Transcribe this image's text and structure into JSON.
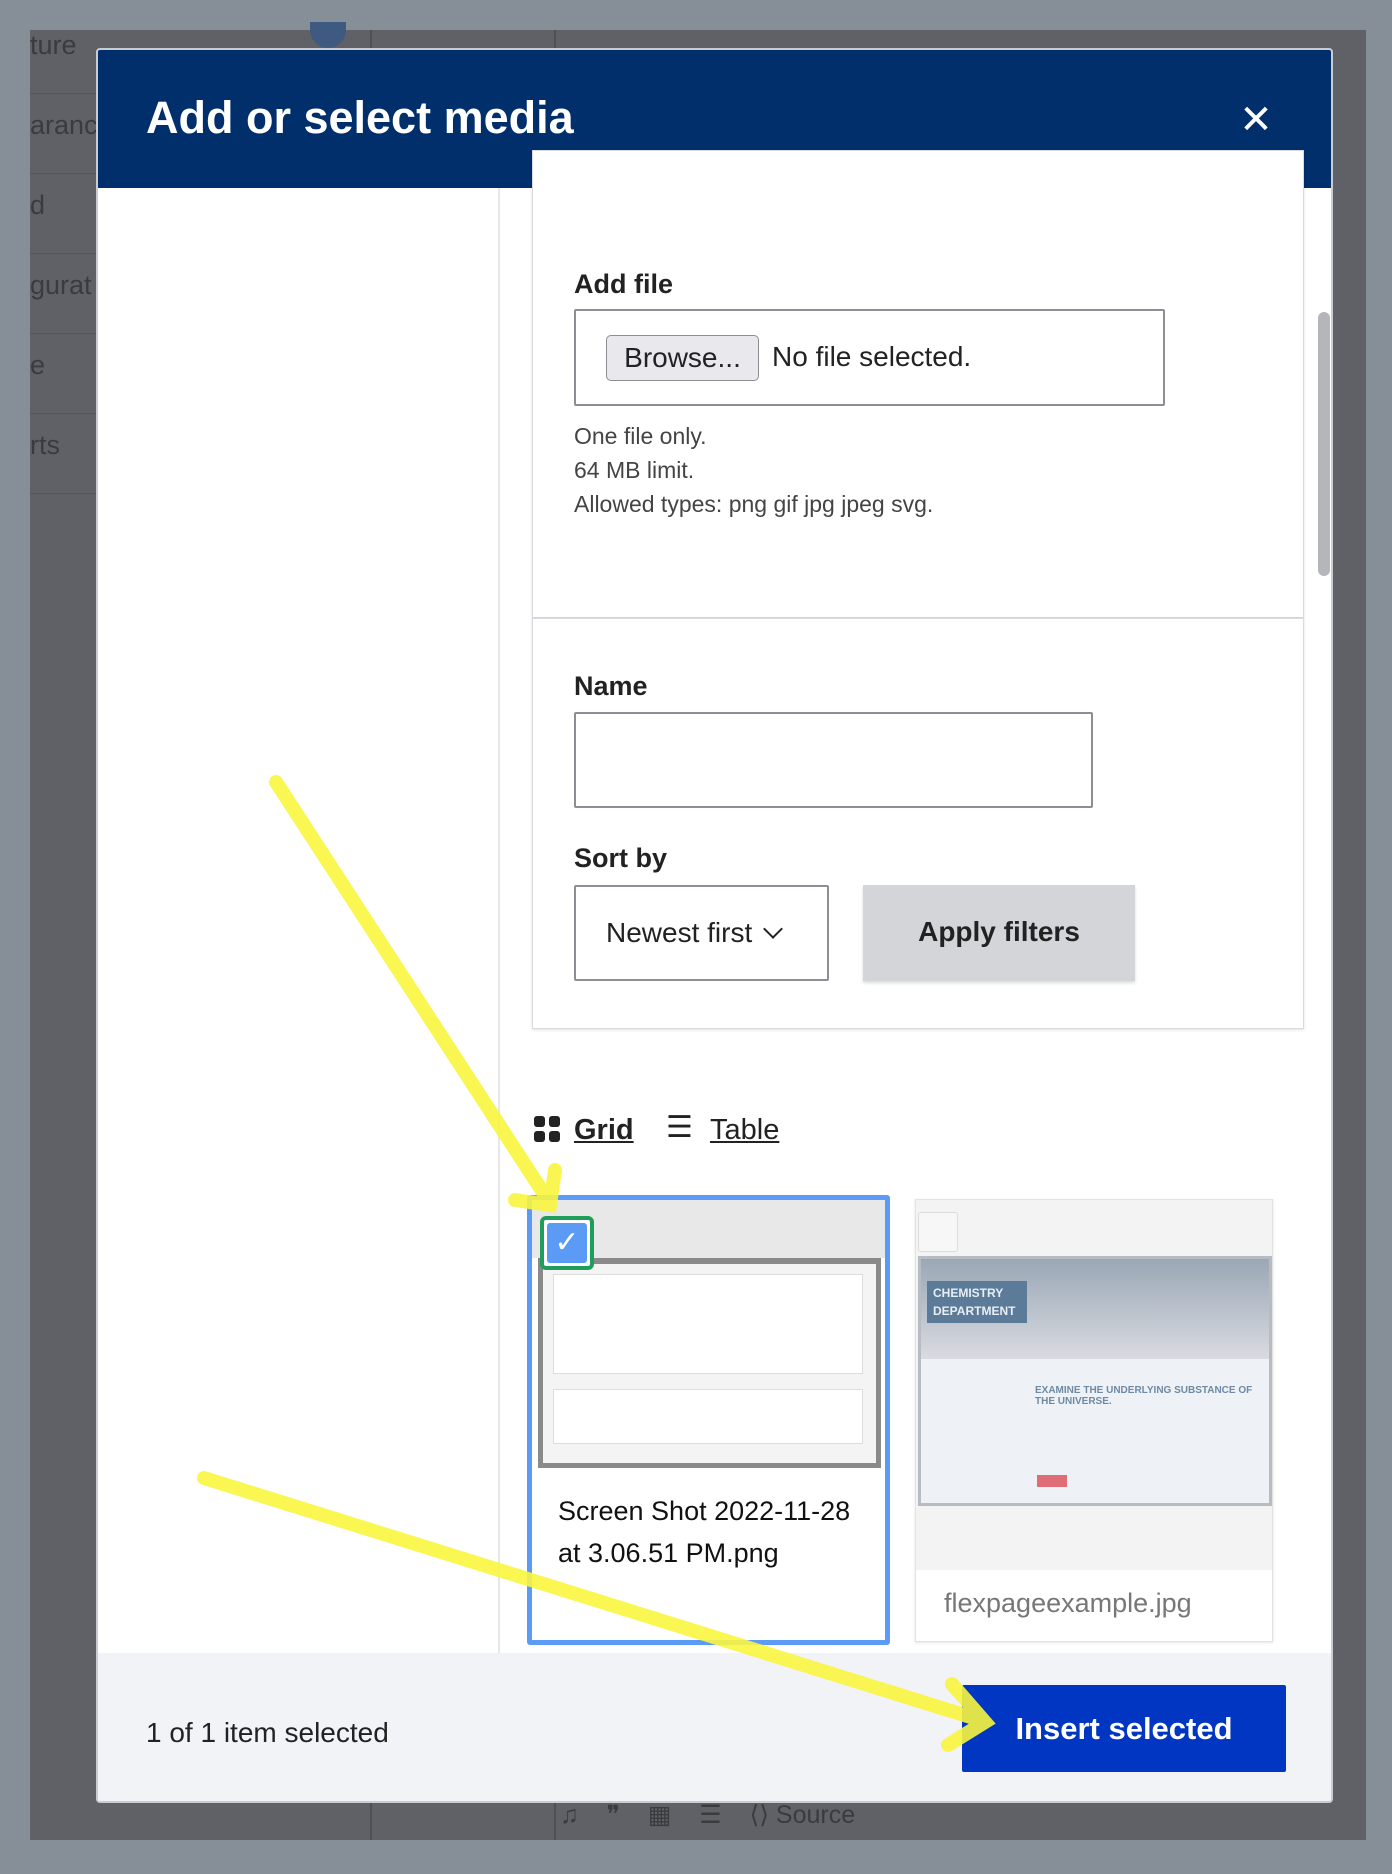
{
  "background": {
    "sidebar_fragments": [
      "ture",
      "aranc",
      "d",
      "gurat",
      "e",
      "rts"
    ],
    "toolbar_source_label": "Source"
  },
  "modal": {
    "title": "Add or select media",
    "close_icon": "close-icon",
    "add_file": {
      "label": "Add file",
      "browse_label": "Browse...",
      "file_status": "No file selected.",
      "help": [
        "One file only.",
        "64 MB limit.",
        "Allowed types: png gif jpg jpeg svg."
      ]
    },
    "filters": {
      "name_label": "Name",
      "name_value": "",
      "sort_label": "Sort by",
      "sort_value": "Newest first",
      "apply_label": "Apply filters"
    },
    "views": {
      "grid_label": "Grid",
      "table_label": "Table"
    },
    "items": [
      {
        "name": "Screen Shot 2022-11-28 at 3.06.51 PM.png",
        "selected": true
      },
      {
        "name": "flexpageexample.jpg",
        "selected": false,
        "thumb_heading": "CHEMISTRY DEPARTMENT",
        "thumb_tagline": "EXAMINE THE UNDERLYING SUBSTANCE OF THE UNIVERSE."
      }
    ],
    "footer": {
      "count": "1 of 1 item selected",
      "insert_label": "Insert selected"
    },
    "colors": {
      "header": "#002f6c",
      "insert": "#0036c1",
      "selected_border": "#5b9af5",
      "checkbox_focus": "#1f9d5a",
      "annotation": "#f9f53f"
    }
  }
}
